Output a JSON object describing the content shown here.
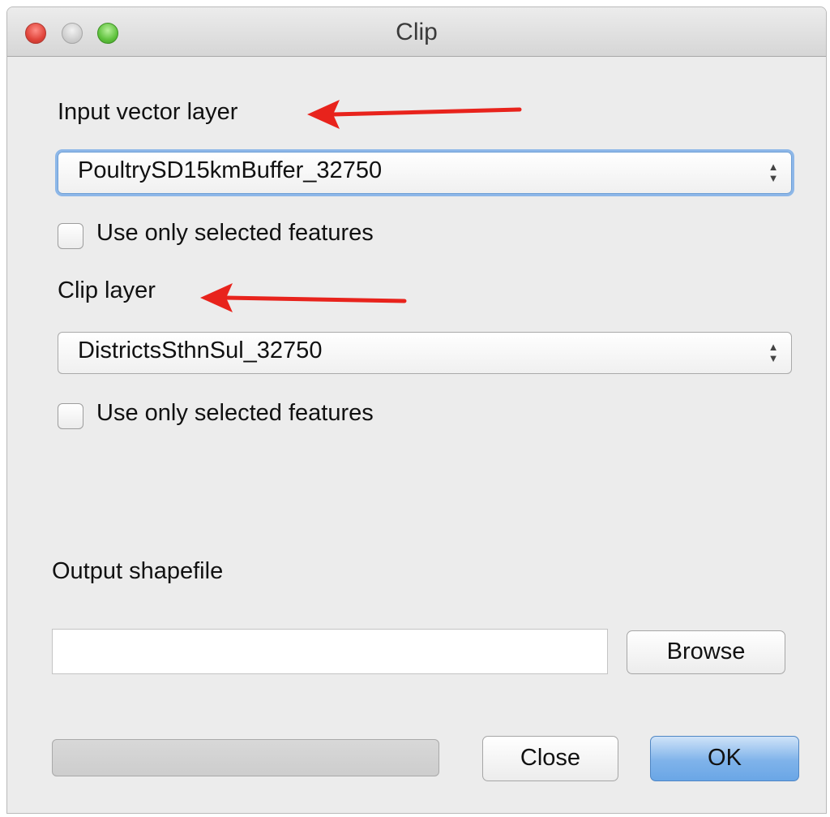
{
  "window": {
    "title": "Clip"
  },
  "input_layer": {
    "label": "Input vector layer",
    "selected": "PoultrySD15kmBuffer_32750",
    "use_selected_label": "Use only selected features"
  },
  "clip_layer": {
    "label": "Clip layer",
    "selected": "DistrictsSthnSul_32750",
    "use_selected_label": "Use only selected features"
  },
  "output": {
    "label": "Output shapefile",
    "value": "",
    "browse_label": "Browse"
  },
  "footer": {
    "close_label": "Close",
    "ok_label": "OK"
  },
  "colors": {
    "annotation_arrow": "#e8231c",
    "default_button": "#7fb3ea"
  },
  "icons": {
    "close": "window-close-icon",
    "minimize": "window-minimize-icon",
    "zoom": "window-zoom-icon",
    "updown": "updown-arrows-icon",
    "annotation": "red-arrow-icon"
  }
}
